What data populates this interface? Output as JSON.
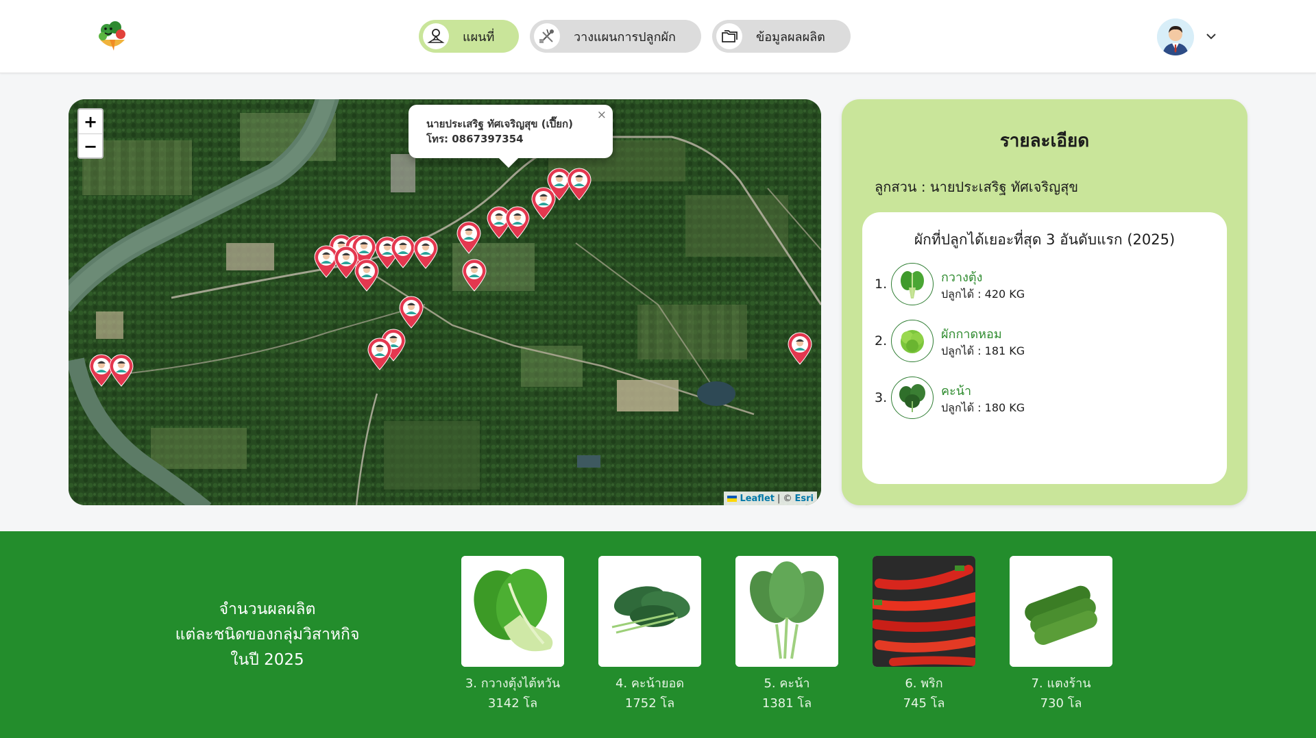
{
  "header": {
    "logo_icon": "vegetable-basket-logo",
    "nav": [
      {
        "label": "แผนที่",
        "icon": "map-pin-person-icon",
        "active": true
      },
      {
        "label": "วางแผนการปลูกผัก",
        "icon": "planting-tools-icon",
        "active": false
      },
      {
        "label": "ข้อมูลผลผลิต",
        "icon": "folders-icon",
        "active": false
      }
    ],
    "user_icon": "user-avatar",
    "menu_icon": "chevron-down-icon"
  },
  "map": {
    "zoom_in": "+",
    "zoom_out": "−",
    "popup": {
      "name": "นายประเสริฐ ทัศเจริญสุข (เปี๊ยก)",
      "phone": "โทร: 0867397354",
      "close": "×"
    },
    "attribution": {
      "leaflet": "Leaflet",
      "separator": "| ©",
      "esri": "Esri"
    },
    "marker_icon": "farmer-location-pin-icon",
    "marker_color": "#e4374f"
  },
  "detail": {
    "title": "รายละเอียด",
    "farmer_label": "ลูกสวน : นายประเสริฐ ทัศเจริญสุข",
    "top_title": "ผักที่ปลูกได้เยอะที่สุด 3 อันดับแรก (2025)",
    "top": [
      {
        "rank": "1.",
        "name": "กวางตุ้ง",
        "amount": "ปลูกได้ : 420 KG"
      },
      {
        "rank": "2.",
        "name": "ผักกาดหอม",
        "amount": "ปลูกได้ : 181 KG"
      },
      {
        "rank": "3.",
        "name": "คะน้า",
        "amount": "ปลูกได้ : 180 KG"
      }
    ]
  },
  "production": {
    "title_lines": [
      "จำนวนผลผลิต",
      "แต่ละชนิดของกลุ่มวิสาหกิจ",
      "ในปี 2025"
    ],
    "items": [
      {
        "name": "3. กวางตุ้งไต้หวัน",
        "amount": "3142 โล"
      },
      {
        "name": "4. คะน้ายอด",
        "amount": "1752 โล"
      },
      {
        "name": "5. คะน้า",
        "amount": "1381 โล"
      },
      {
        "name": "6. พริก",
        "amount": "745 โล"
      },
      {
        "name": "7. แตงร้าน",
        "amount": "730 โล"
      }
    ]
  },
  "colors": {
    "active_nav": "#c9e59a",
    "inactive_nav": "#dcdcdc",
    "detail_bg": "#c9e59a",
    "band_bg": "#238d2c",
    "accent_text": "#2e8b2e"
  }
}
